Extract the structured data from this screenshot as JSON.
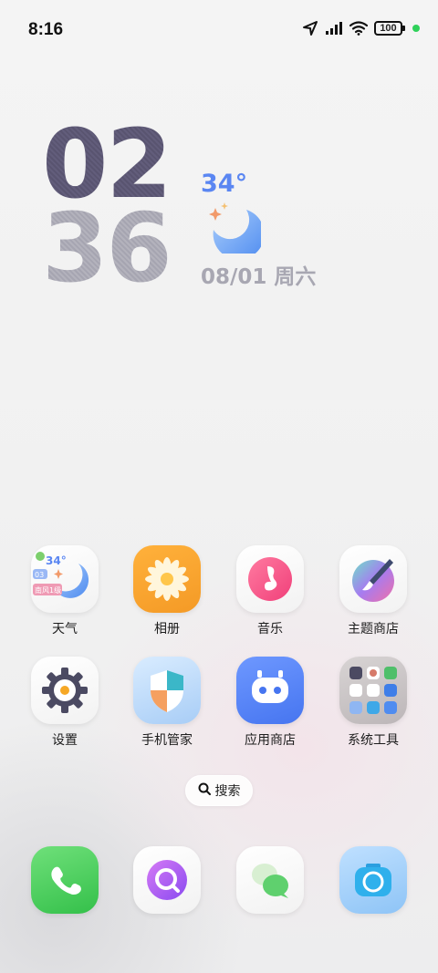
{
  "status_bar": {
    "time": "8:16",
    "battery": "100",
    "icons": [
      "location-icon",
      "signal-icon",
      "wifi-icon",
      "battery-icon",
      "green-dot"
    ]
  },
  "clock": {
    "hours": "02",
    "minutes": "36",
    "temperature": "34°",
    "date": "08/01 周六",
    "weather_icon": "moon-icon"
  },
  "apps": [
    {
      "label": "天气",
      "icon": "weather-icon",
      "widget_temp": "34°",
      "widget_badge": "03",
      "widget_note": "南风1级"
    },
    {
      "label": "相册",
      "icon": "gallery-flower-icon"
    },
    {
      "label": "音乐",
      "icon": "music-note-icon"
    },
    {
      "label": "主题商店",
      "icon": "theme-brush-icon"
    },
    {
      "label": "设置",
      "icon": "gear-icon"
    },
    {
      "label": "手机管家",
      "icon": "shield-icon"
    },
    {
      "label": "应用商店",
      "icon": "app-store-robot-icon"
    },
    {
      "label": "系统工具",
      "icon": "tools-folder-icon"
    }
  ],
  "search": {
    "label": "搜索",
    "icon": "search-icon"
  },
  "dock": [
    {
      "name": "phone",
      "icon": "phone-icon"
    },
    {
      "name": "browser",
      "icon": "browser-search-icon"
    },
    {
      "name": "messages",
      "icon": "message-bubbles-icon"
    },
    {
      "name": "camera",
      "icon": "camera-icon"
    }
  ],
  "colors": {
    "clock_hours": "#5b5673",
    "clock_minutes": "#a8a7b2",
    "temp_accent": "#5a86f2",
    "status_dot": "#2fd15a"
  }
}
